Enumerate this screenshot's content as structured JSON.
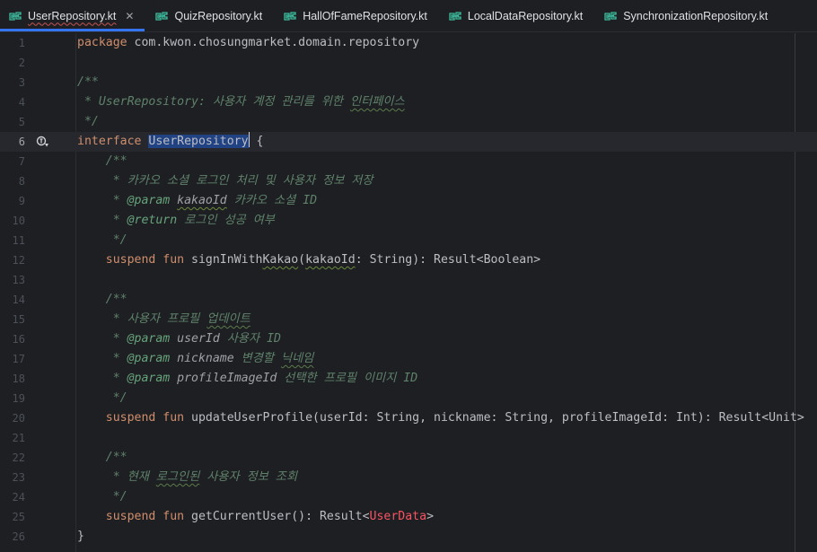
{
  "tabs": [
    {
      "label": "UserRepository.kt",
      "active": true,
      "closable": true
    },
    {
      "label": "QuizRepository.kt",
      "active": false
    },
    {
      "label": "HallOfFameRepository.kt",
      "active": false
    },
    {
      "label": "LocalDataRepository.kt",
      "active": false
    },
    {
      "label": "SynchronizationRepository.kt",
      "active": false
    }
  ],
  "close_glyph": "✕",
  "colors": {
    "keyword": "#cf8e6d",
    "comment": "#7a7e85",
    "doc_comment": "#5f826b",
    "kotlin_icon": "#3dbfa0",
    "selection": "#214283",
    "tab_underline": "#3574f0"
  },
  "current_line": 6,
  "lines": [
    {
      "n": "1",
      "tokens": [
        [
          "kw",
          "package"
        ],
        [
          "tx",
          " com.kwon.chosungmarket.domain.repository"
        ]
      ]
    },
    {
      "n": "2",
      "tokens": []
    },
    {
      "n": "3",
      "tokens": [
        [
          "dt",
          "/**"
        ]
      ]
    },
    {
      "n": "4",
      "tokens": [
        [
          "dt",
          " * UserRepository: 사용자 계정 관리를 위한 "
        ],
        [
          "dtw",
          "인터페이스"
        ]
      ]
    },
    {
      "n": "5",
      "tokens": [
        [
          "dt",
          " */"
        ]
      ]
    },
    {
      "n": "6",
      "tokens": [
        [
          "kw",
          "interface "
        ],
        [
          "sel",
          "UserRepository"
        ],
        [
          "caret",
          ""
        ],
        [
          "tx",
          " {"
        ]
      ]
    },
    {
      "n": "7",
      "tokens": [
        [
          "tx",
          "    "
        ],
        [
          "dt",
          "/**"
        ]
      ]
    },
    {
      "n": "8",
      "tokens": [
        [
          "tx",
          "    "
        ],
        [
          "dt",
          " * 카카오 소셜 로그인 처리 및 사용자 정보 저장"
        ]
      ]
    },
    {
      "n": "9",
      "tokens": [
        [
          "tx",
          "    "
        ],
        [
          "dt",
          " * "
        ],
        [
          "tag",
          "@param "
        ],
        [
          "pnw",
          "kakaoId"
        ],
        [
          "dt",
          " 카카오 소셜 ID"
        ]
      ]
    },
    {
      "n": "10",
      "tokens": [
        [
          "tx",
          "    "
        ],
        [
          "dt",
          " * "
        ],
        [
          "tag",
          "@return"
        ],
        [
          "dt",
          " 로그인 성공 여부"
        ]
      ]
    },
    {
      "n": "11",
      "tokens": [
        [
          "tx",
          "    "
        ],
        [
          "dt",
          " */"
        ]
      ]
    },
    {
      "n": "12",
      "tokens": [
        [
          "tx",
          "    "
        ],
        [
          "kw",
          "suspend fun "
        ],
        [
          "fn",
          "signInWith"
        ],
        [
          "fnw",
          "Kakao"
        ],
        [
          "tx",
          "("
        ],
        [
          "txw",
          "kakaoId"
        ],
        [
          "tx",
          ": String): Result<Boolean>"
        ]
      ]
    },
    {
      "n": "13",
      "tokens": []
    },
    {
      "n": "14",
      "tokens": [
        [
          "tx",
          "    "
        ],
        [
          "dt",
          "/**"
        ]
      ]
    },
    {
      "n": "15",
      "tokens": [
        [
          "tx",
          "    "
        ],
        [
          "dt",
          " * 사용자 프로필 "
        ],
        [
          "dtw",
          "업데이트"
        ]
      ]
    },
    {
      "n": "16",
      "tokens": [
        [
          "tx",
          "    "
        ],
        [
          "dt",
          " * "
        ],
        [
          "tag",
          "@param "
        ],
        [
          "pn",
          "userId"
        ],
        [
          "dt",
          " 사용자 ID"
        ]
      ]
    },
    {
      "n": "17",
      "tokens": [
        [
          "tx",
          "    "
        ],
        [
          "dt",
          " * "
        ],
        [
          "tag",
          "@param "
        ],
        [
          "pn",
          "nickname"
        ],
        [
          "dt",
          " 변경할 "
        ],
        [
          "dtw",
          "닉네임"
        ]
      ]
    },
    {
      "n": "18",
      "tokens": [
        [
          "tx",
          "    "
        ],
        [
          "dt",
          " * "
        ],
        [
          "tag",
          "@param "
        ],
        [
          "pn",
          "profileImageId"
        ],
        [
          "dt",
          " 선택한 프로필 이미지 ID"
        ]
      ]
    },
    {
      "n": "19",
      "tokens": [
        [
          "tx",
          "    "
        ],
        [
          "dt",
          " */"
        ]
      ]
    },
    {
      "n": "20",
      "tokens": [
        [
          "tx",
          "    "
        ],
        [
          "kw",
          "suspend fun "
        ],
        [
          "fn",
          "updateUserProfile"
        ],
        [
          "tx",
          "(userId: String, nickname: String, profileImageId: Int): Result<Unit>"
        ]
      ]
    },
    {
      "n": "21",
      "tokens": []
    },
    {
      "n": "22",
      "tokens": [
        [
          "tx",
          "    "
        ],
        [
          "dt",
          "/**"
        ]
      ]
    },
    {
      "n": "23",
      "tokens": [
        [
          "tx",
          "    "
        ],
        [
          "dt",
          " * 현재 "
        ],
        [
          "dtw",
          "로그인된"
        ],
        [
          "dt",
          " 사용자 정보 조회"
        ]
      ]
    },
    {
      "n": "24",
      "tokens": [
        [
          "tx",
          "    "
        ],
        [
          "dt",
          " */"
        ]
      ]
    },
    {
      "n": "25",
      "tokens": [
        [
          "tx",
          "    "
        ],
        [
          "kw",
          "suspend fun "
        ],
        [
          "fn",
          "getCurrentUser"
        ],
        [
          "tx",
          "(): Result<"
        ],
        [
          "err",
          "UserData"
        ],
        [
          "tx",
          ">"
        ]
      ]
    },
    {
      "n": "26",
      "tokens": [
        [
          "tx",
          "}"
        ]
      ]
    }
  ]
}
